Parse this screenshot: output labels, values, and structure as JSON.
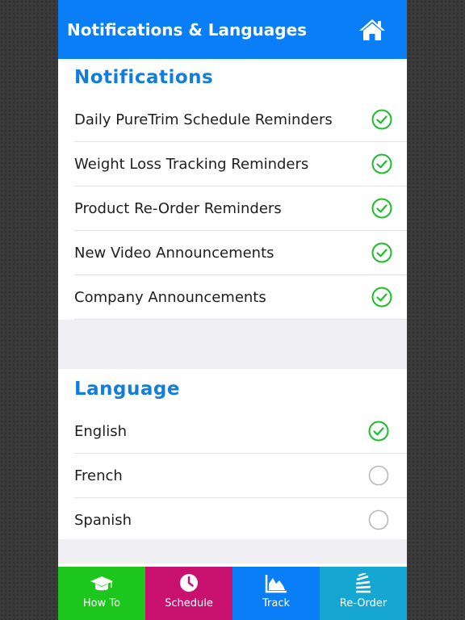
{
  "header": {
    "title": "Notifications & Languages",
    "home_icon": "home-icon"
  },
  "notifications": {
    "title": "Notifications",
    "items": [
      {
        "label": "Daily PureTrim Schedule Reminders",
        "checked": true
      },
      {
        "label": "Weight Loss Tracking Reminders",
        "checked": true
      },
      {
        "label": "Product Re-Order Reminders",
        "checked": true
      },
      {
        "label": "New Video Announcements",
        "checked": true
      },
      {
        "label": "Company Announcements",
        "checked": true
      }
    ]
  },
  "language": {
    "title": "Language",
    "items": [
      {
        "label": "English",
        "selected": true
      },
      {
        "label": "French",
        "selected": false
      },
      {
        "label": "Spanish",
        "selected": false
      }
    ]
  },
  "tabs": [
    {
      "label": "How To",
      "icon": "graduation-cap-icon",
      "color": "#1cc61c"
    },
    {
      "label": "Schedule",
      "icon": "clock-icon",
      "color": "#c8106e"
    },
    {
      "label": "Track",
      "icon": "area-chart-icon",
      "color": "#0a7ef6"
    },
    {
      "label": "Re-Order",
      "icon": "stack-icon",
      "color": "#16a6d2"
    }
  ],
  "colors": {
    "header": "#0a7ef6",
    "section_title": "#137ddc",
    "check": "#1cbf2a",
    "radio": "#b8b8b8"
  }
}
